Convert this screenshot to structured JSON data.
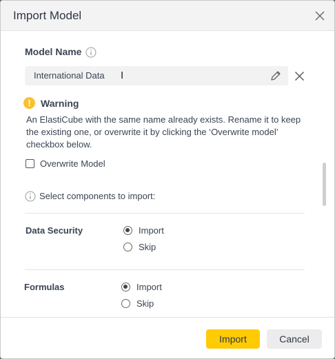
{
  "dialog": {
    "title": "Import Model"
  },
  "model_name": {
    "label": "Model Name",
    "value": "International Data"
  },
  "warning": {
    "icon_glyph": "!",
    "title": "Warning",
    "text": "An ElastiCube with the same name already exists. Rename it to keep the existing one, or overwrite it by clicking the ‘Overwrite model’ checkbox below."
  },
  "overwrite": {
    "label": "Overwrite Model",
    "checked": false
  },
  "components": {
    "prompt": "Select components to import:",
    "sections": [
      {
        "label": "Data Security",
        "options": [
          {
            "label": "Import",
            "selected": true
          },
          {
            "label": "Skip",
            "selected": false
          }
        ]
      },
      {
        "label": "Formulas",
        "options": [
          {
            "label": "Import",
            "selected": true
          },
          {
            "label": "Skip",
            "selected": false
          }
        ]
      }
    ]
  },
  "footer": {
    "import_label": "Import",
    "cancel_label": "Cancel"
  },
  "colors": {
    "primary_button": "#ffcb05",
    "warning_icon": "#fbc02d",
    "header_bg": "#f3f3f4"
  },
  "icons": [
    "close-icon",
    "info-icon",
    "pencil-icon",
    "clear-icon",
    "warning-icon",
    "text-cursor-icon"
  ]
}
